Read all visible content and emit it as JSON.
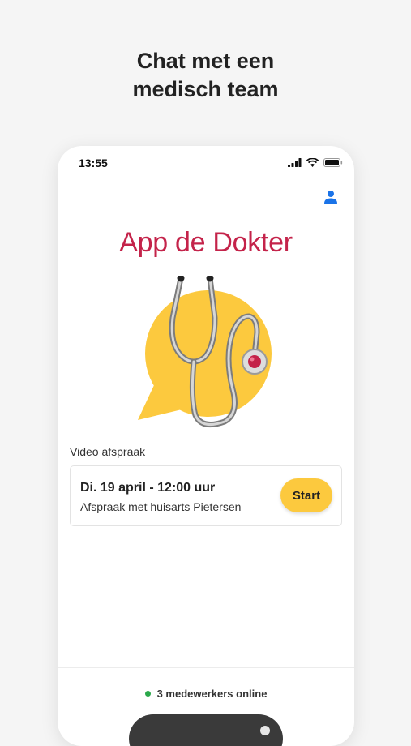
{
  "headline": {
    "line1": "Chat met een",
    "line2": "medisch team"
  },
  "status_bar": {
    "time": "13:55"
  },
  "app": {
    "title": "App de Dokter"
  },
  "section": {
    "label": "Video afspraak"
  },
  "appointment": {
    "date": "Di. 19 april - 12:00 uur",
    "description": "Afspraak met huisarts Pietersen",
    "start_label": "Start"
  },
  "footer": {
    "online_text": "3 medewerkers online"
  },
  "colors": {
    "brand": "#c4234a",
    "accent": "#fcc93e",
    "online": "#2aa84a",
    "profile": "#1a73e8"
  }
}
